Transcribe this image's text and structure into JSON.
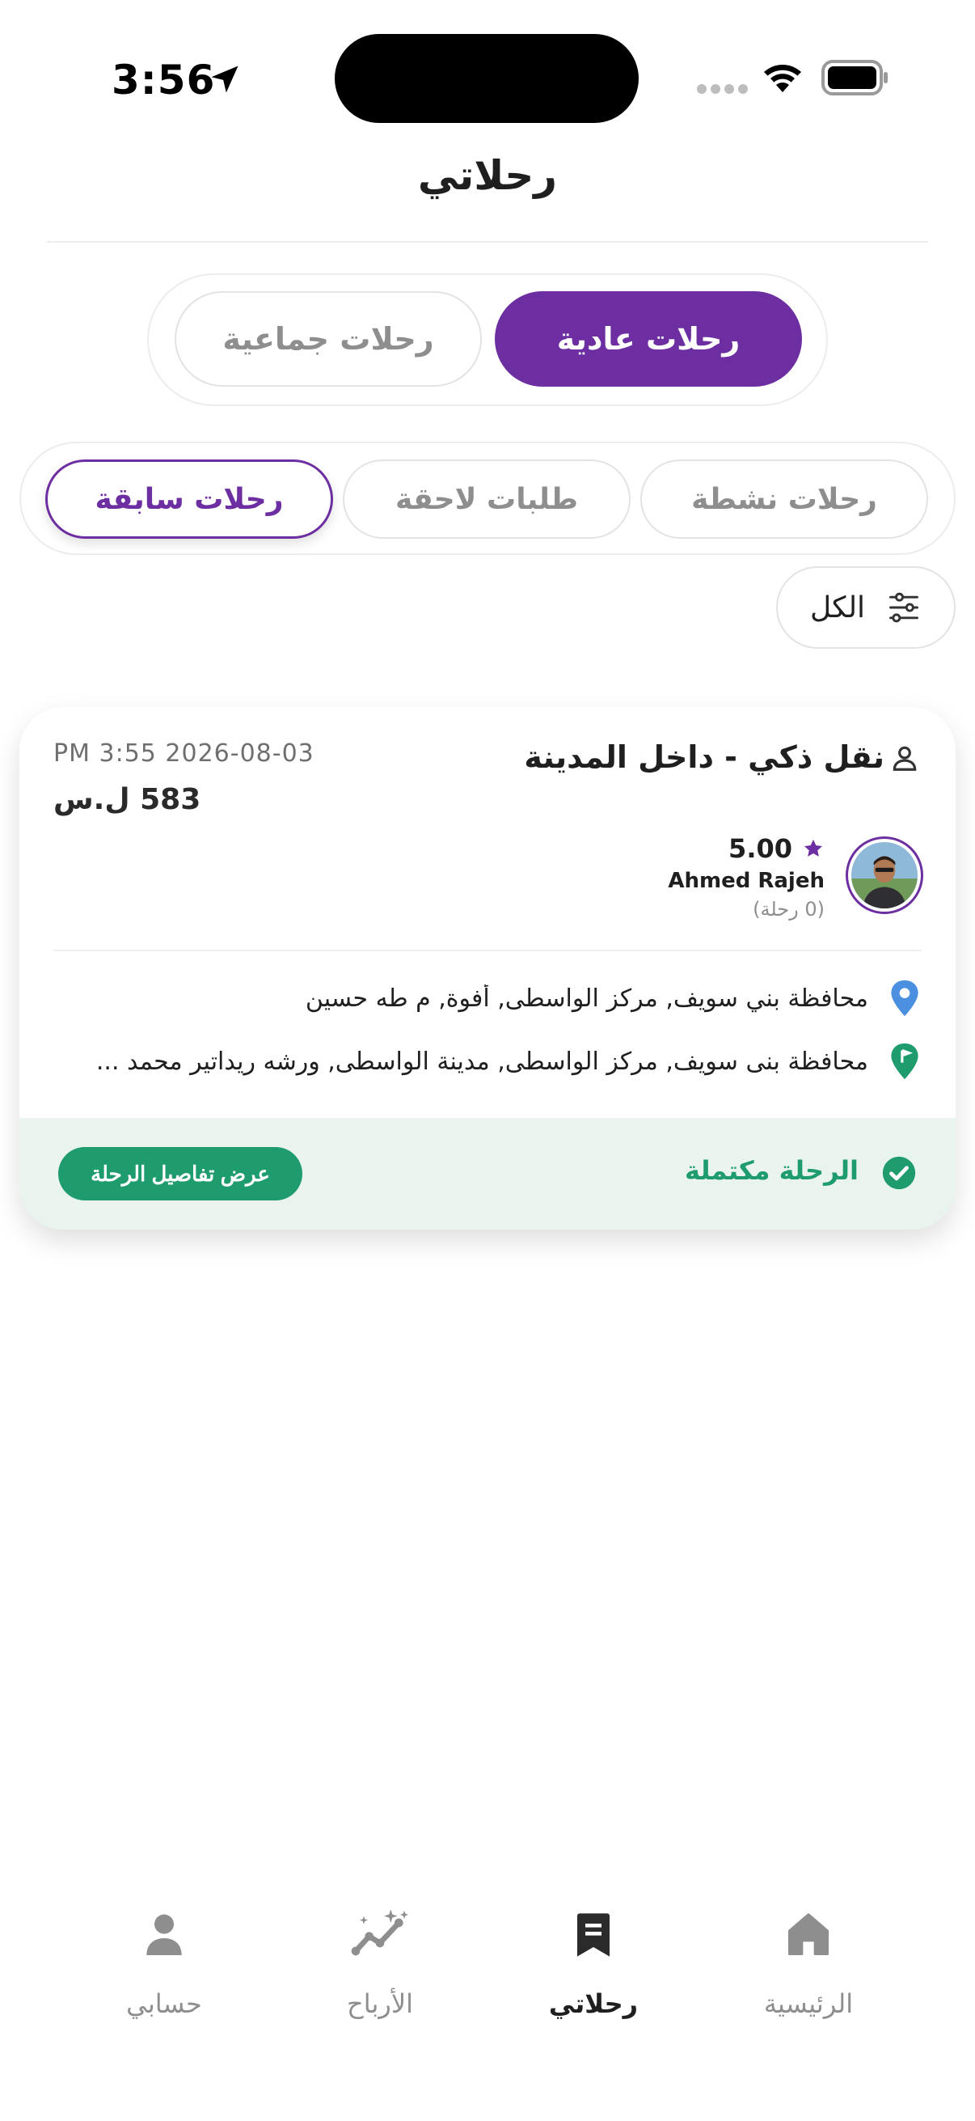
{
  "status_bar": {
    "time": "3:56"
  },
  "header": {
    "title": "رحلاتي"
  },
  "trip_type": {
    "options": [
      "رحلات عادية",
      "رحلات جماعية"
    ],
    "selected": "رحلات عادية"
  },
  "status_tabs": {
    "tabs": [
      "رحلات نشطة",
      "طلبات لاحقة",
      "رحلات سابقة"
    ],
    "selected": "رحلات سابقة"
  },
  "filter": {
    "label": "الكل",
    "icon": "sliders-icon"
  },
  "trip": {
    "title": "نقل ذكي - داخل المدينة",
    "datetime": "PM 3:55 2026-08-03",
    "price": "583 ل.س",
    "driver": {
      "rating": "5.00",
      "name": "Ahmed Rajeh",
      "trips_count": "(0 رحلة)"
    },
    "pickup": "محافظة بني سويف, مركز الواسطى, أفوة, م طه حسين",
    "dropoff": "محافظة بنى سويف, مركز الواسطى, مدينة الواسطى, ورشه ريداتير محمد ...",
    "status": "الرحلة مكتملة",
    "details_button": "عرض تفاصيل الرحلة"
  },
  "bottom_nav": {
    "items": [
      {
        "label": "الرئيسية",
        "icon": "home-icon"
      },
      {
        "label": "رحلاتي",
        "icon": "bookmark-icon"
      },
      {
        "label": "الأرباح",
        "icon": "earnings-chart-icon"
      },
      {
        "label": "حسابي",
        "icon": "person-icon"
      }
    ],
    "active": "رحلاتي"
  },
  "colors": {
    "primary": "#6c2ea0",
    "success": "#1f9c6e",
    "success_bg": "#eaf4ee",
    "muted": "#8e8e8e",
    "pickup_pin": "#4a8fe0",
    "dropoff_pin": "#1f9c6e"
  }
}
